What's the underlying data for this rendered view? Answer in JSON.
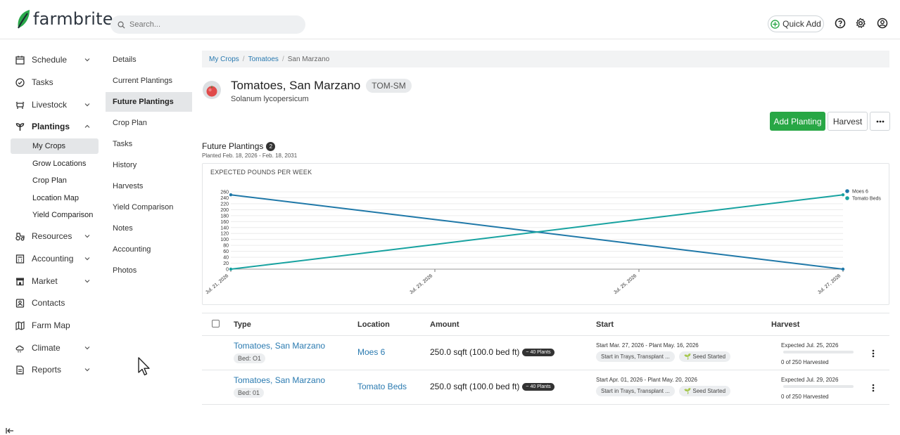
{
  "header": {
    "brand": "farmbrite",
    "search_placeholder": "Search...",
    "quick_add": "Quick Add",
    "icons": [
      "help-icon",
      "gear-icon",
      "user-icon"
    ]
  },
  "sidebar": {
    "items": [
      {
        "label": "Schedule",
        "icon": "calendar-icon",
        "chevron": true
      },
      {
        "label": "Tasks",
        "icon": "check-circle-icon",
        "chevron": false
      },
      {
        "label": "Livestock",
        "icon": "cow-icon",
        "chevron": true
      },
      {
        "label": "Plantings",
        "icon": "sprout-icon",
        "chevron": true,
        "expanded": true
      },
      {
        "label": "Resources",
        "icon": "tractor-icon",
        "chevron": true
      },
      {
        "label": "Accounting",
        "icon": "calculator-icon",
        "chevron": true
      },
      {
        "label": "Market",
        "icon": "store-icon",
        "chevron": true
      },
      {
        "label": "Contacts",
        "icon": "contact-icon",
        "chevron": false
      },
      {
        "label": "Farm Map",
        "icon": "map-icon",
        "chevron": false
      },
      {
        "label": "Climate",
        "icon": "cloud-icon",
        "chevron": true
      },
      {
        "label": "Reports",
        "icon": "report-icon",
        "chevron": true
      }
    ],
    "plantings_sub": [
      "My Crops",
      "Grow Locations",
      "Crop Plan",
      "Location Map",
      "Yield Comparison"
    ],
    "active_sub": "My Crops"
  },
  "submenu": {
    "items": [
      "Details",
      "Current Plantings",
      "Future Plantings",
      "Crop Plan",
      "Tasks",
      "History",
      "Harvests",
      "Yield Comparison",
      "Notes",
      "Accounting",
      "Photos"
    ],
    "active": "Future Plantings"
  },
  "breadcrumb": {
    "items": [
      "My Crops",
      "Tomatoes",
      "San Marzano"
    ]
  },
  "crop": {
    "name": "Tomatoes, San Marzano",
    "code": "TOM-SM",
    "scientific": "Solanum lycopersicum"
  },
  "actions": {
    "add": "Add Planting",
    "harvest": "Harvest"
  },
  "future": {
    "title": "Future Plantings",
    "count": "2",
    "range": "Planted Feb. 18, 2026 - Feb. 18, 2031"
  },
  "chart_data": {
    "type": "line",
    "title": "EXPECTED POUNDS PER WEEK",
    "x": [
      "Jul. 21, 2026",
      "Jul. 23, 2026",
      "Jul. 25, 2026",
      "Jul. 27, 2026"
    ],
    "series": [
      {
        "name": "Moes 6",
        "color": "#1f78a8",
        "values": [
          250,
          167,
          83,
          0
        ]
      },
      {
        "name": "Tomato Beds",
        "color": "#17a2a0",
        "values": [
          0,
          83,
          167,
          250
        ]
      }
    ],
    "yticks": [
      0,
      20,
      40,
      60,
      80,
      100,
      120,
      140,
      160,
      180,
      200,
      220,
      240,
      260
    ],
    "ylim": [
      0,
      260
    ],
    "grid": true,
    "legend": "top-right"
  },
  "table": {
    "headers": [
      "Type",
      "Location",
      "Amount",
      "Start",
      "Harvest"
    ],
    "rows": [
      {
        "type": "Tomatoes, San Marzano",
        "bed": "Bed: O1",
        "location": "Moes 6",
        "amount": "250.0 sqft (100.0 bed ft)",
        "plants": "~ 40 Plants",
        "start": "Start Mar. 27, 2026 - Plant May. 16, 2026",
        "method": "Start in Trays, Transplant ...",
        "status": "Seed Started",
        "expected": "Expected Jul. 25, 2026",
        "harvested": "0 of 250 Harvested",
        "progress": 0
      },
      {
        "type": "Tomatoes, San Marzano",
        "bed": "Bed: 01",
        "location": "Tomato Beds",
        "amount": "250.0 sqft (100.0 bed ft)",
        "plants": "~ 40 Plants",
        "start": "Start Apr. 01, 2026 - Plant May. 20, 2026",
        "method": "Start in Trays, Transplant ...",
        "status": "Seed Started",
        "expected": "Expected Jul. 29, 2026",
        "harvested": "0 of 250 Harvested",
        "progress": 0
      }
    ]
  }
}
